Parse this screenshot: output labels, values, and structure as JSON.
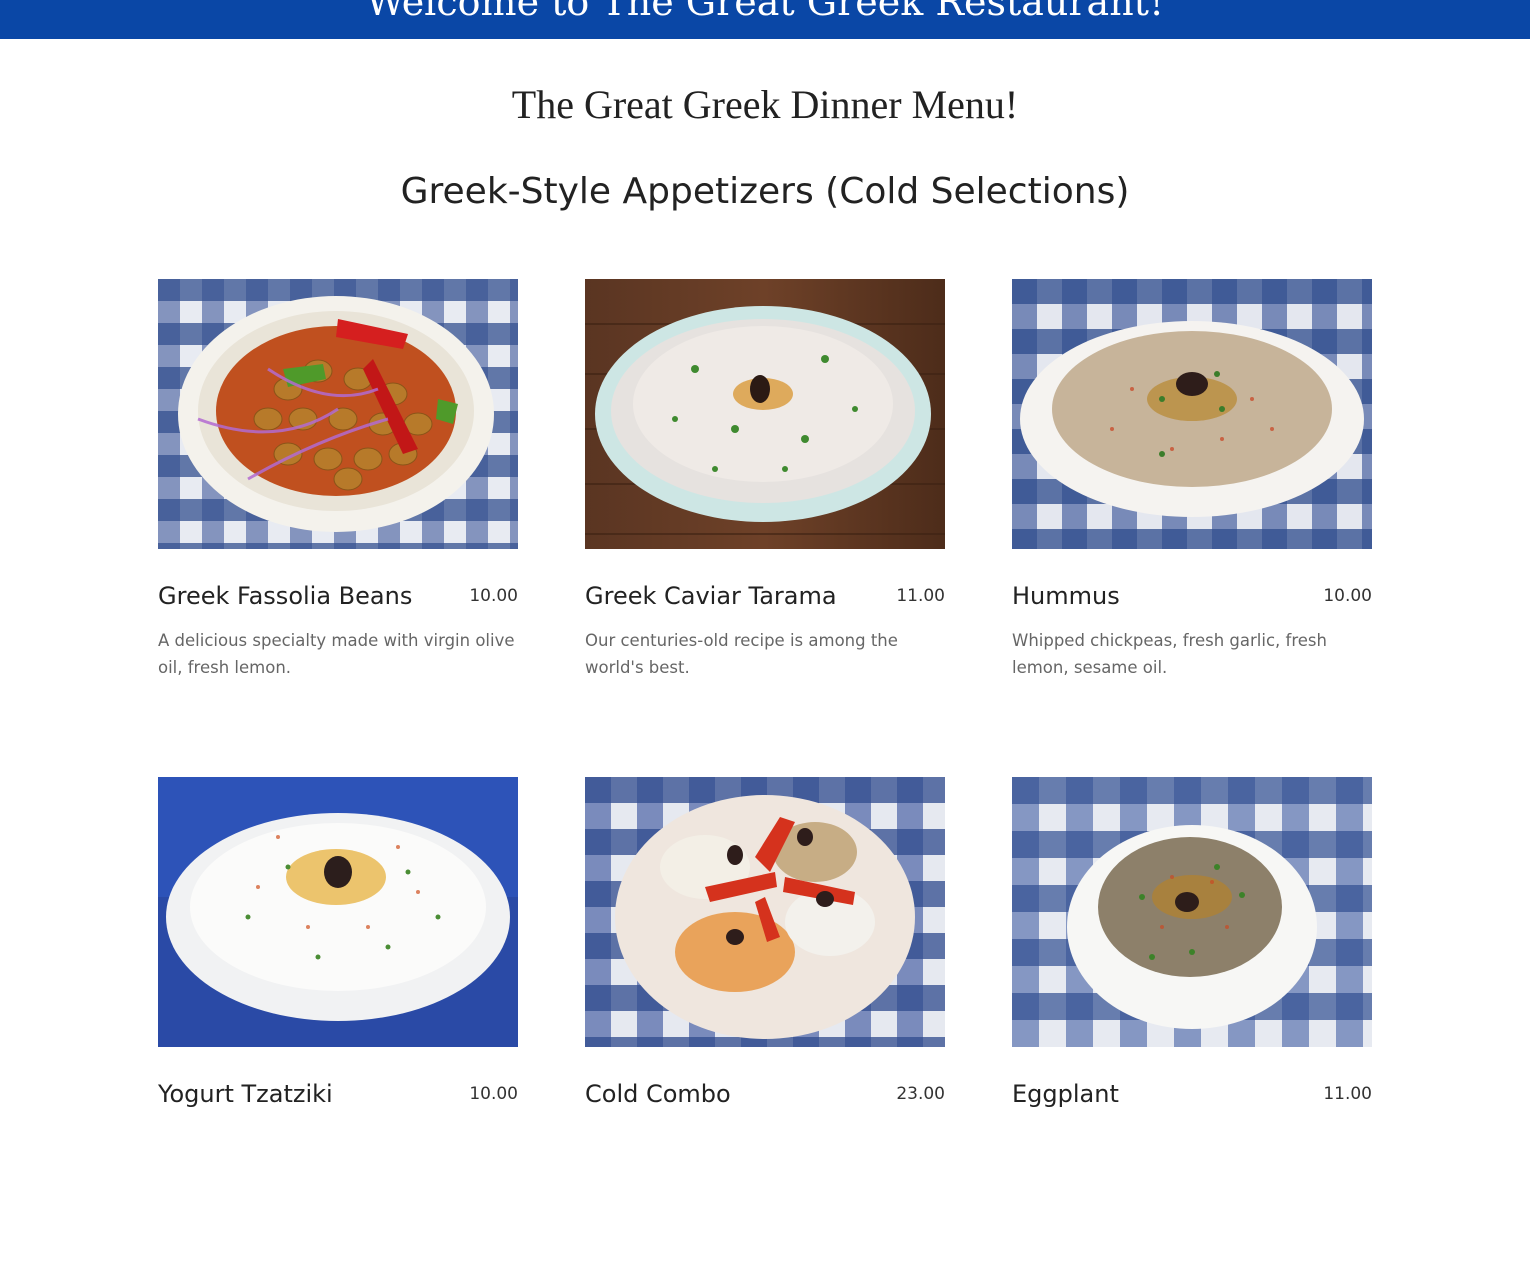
{
  "banner": {
    "title": "Welcome to The Great Greek Restaurant!",
    "color": "#0a47a6"
  },
  "menu_title": "The Great Greek Dinner Menu!",
  "section_title": "Greek-Style Appetizers (Cold Selections)",
  "items": [
    {
      "name": "Greek Fassolia Beans",
      "price": "10.00",
      "description": "A delicious specialty made with virgin olive oil, fresh lemon.",
      "photo": "photo-beans"
    },
    {
      "name": "Greek Caviar Tarama",
      "price": "11.00",
      "description": "Our centuries-old recipe is among the world's best.",
      "photo": "photo-tarama"
    },
    {
      "name": "Hummus",
      "price": "10.00",
      "description": "Whipped chickpeas, fresh garlic, fresh lemon, sesame oil.",
      "photo": "photo-hummus"
    },
    {
      "name": "Yogurt Tzatziki",
      "price": "10.00",
      "description": "",
      "photo": "photo-tzatziki"
    },
    {
      "name": "Cold Combo",
      "price": "23.00",
      "description": "",
      "photo": "photo-cold-combo"
    },
    {
      "name": "Eggplant",
      "price": "11.00",
      "description": "",
      "photo": "photo-eggplant"
    }
  ]
}
